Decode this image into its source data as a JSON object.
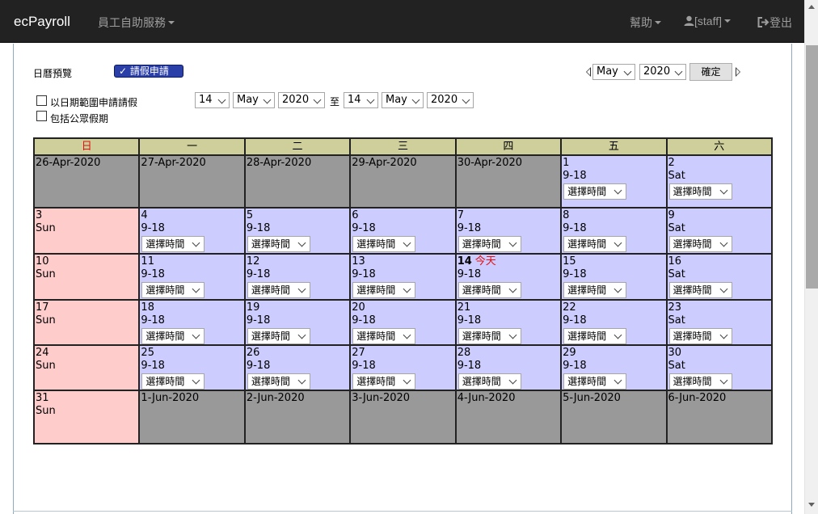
{
  "navbar": {
    "brand": "ecPayroll",
    "menu": "員工自助服務",
    "help": "幫助",
    "user": "[staff]",
    "logout": "登出"
  },
  "toolbar": {
    "calendar_preview": "日曆預覽",
    "leave_button": "請假申請",
    "month": "May",
    "year": "2020",
    "confirm": "確定"
  },
  "range": {
    "by_date_range_label": "以日期範圍申請請假",
    "include_holidays_label": "包括公眾假期",
    "from_day": "14",
    "from_month": "May",
    "from_year": "2020",
    "to_label": "至",
    "to_day": "14",
    "to_month": "May",
    "to_year": "2020"
  },
  "calendar": {
    "headers": [
      "日",
      "一",
      "二",
      "三",
      "四",
      "五",
      "六"
    ],
    "select_placeholder": "選擇時間",
    "today_label": "今天",
    "weeks": [
      [
        {
          "l1": "26-Apr-2020",
          "type": "gray"
        },
        {
          "l1": "27-Apr-2020",
          "type": "gray"
        },
        {
          "l1": "28-Apr-2020",
          "type": "gray"
        },
        {
          "l1": "29-Apr-2020",
          "type": "gray"
        },
        {
          "l1": "30-Apr-2020",
          "type": "gray"
        },
        {
          "l1": "1",
          "l2": "9-18",
          "type": "blue",
          "select": true
        },
        {
          "l1": "2",
          "l2": "Sat",
          "type": "blue",
          "select": true
        }
      ],
      [
        {
          "l1": "3",
          "l2": "Sun",
          "type": "pink"
        },
        {
          "l1": "4",
          "l2": "9-18",
          "type": "blue",
          "select": true
        },
        {
          "l1": "5",
          "l2": "9-18",
          "type": "blue",
          "select": true
        },
        {
          "l1": "6",
          "l2": "9-18",
          "type": "blue",
          "select": true
        },
        {
          "l1": "7",
          "l2": "9-18",
          "type": "blue",
          "select": true
        },
        {
          "l1": "8",
          "l2": "9-18",
          "type": "blue",
          "select": true
        },
        {
          "l1": "9",
          "l2": "Sat",
          "type": "blue",
          "select": true
        }
      ],
      [
        {
          "l1": "10",
          "l2": "Sun",
          "type": "pink"
        },
        {
          "l1": "11",
          "l2": "9-18",
          "type": "blue",
          "select": true
        },
        {
          "l1": "12",
          "l2": "9-18",
          "type": "blue",
          "select": true
        },
        {
          "l1": "13",
          "l2": "9-18",
          "type": "blue",
          "select": true
        },
        {
          "l1": "14",
          "l2": "9-18",
          "type": "blue",
          "select": true,
          "today": true
        },
        {
          "l1": "15",
          "l2": "9-18",
          "type": "blue",
          "select": true
        },
        {
          "l1": "16",
          "l2": "Sat",
          "type": "blue",
          "select": true
        }
      ],
      [
        {
          "l1": "17",
          "l2": "Sun",
          "type": "pink"
        },
        {
          "l1": "18",
          "l2": "9-18",
          "type": "blue",
          "select": true
        },
        {
          "l1": "19",
          "l2": "9-18",
          "type": "blue",
          "select": true
        },
        {
          "l1": "20",
          "l2": "9-18",
          "type": "blue",
          "select": true
        },
        {
          "l1": "21",
          "l2": "9-18",
          "type": "blue",
          "select": true
        },
        {
          "l1": "22",
          "l2": "9-18",
          "type": "blue",
          "select": true
        },
        {
          "l1": "23",
          "l2": "Sat",
          "type": "blue",
          "select": true
        }
      ],
      [
        {
          "l1": "24",
          "l2": "Sun",
          "type": "pink"
        },
        {
          "l1": "25",
          "l2": "9-18",
          "type": "blue",
          "select": true
        },
        {
          "l1": "26",
          "l2": "9-18",
          "type": "blue",
          "select": true
        },
        {
          "l1": "27",
          "l2": "9-18",
          "type": "blue",
          "select": true
        },
        {
          "l1": "28",
          "l2": "9-18",
          "type": "blue",
          "select": true
        },
        {
          "l1": "29",
          "l2": "9-18",
          "type": "blue",
          "select": true
        },
        {
          "l1": "30",
          "l2": "Sat",
          "type": "blue",
          "select": true
        }
      ],
      [
        {
          "l1": "31",
          "l2": "Sun",
          "type": "pink"
        },
        {
          "l1": "1-Jun-2020",
          "type": "gray"
        },
        {
          "l1": "2-Jun-2020",
          "type": "gray"
        },
        {
          "l1": "3-Jun-2020",
          "type": "gray"
        },
        {
          "l1": "4-Jun-2020",
          "type": "gray"
        },
        {
          "l1": "5-Jun-2020",
          "type": "gray"
        },
        {
          "l1": "6-Jun-2020",
          "type": "gray"
        }
      ]
    ]
  },
  "colors": {
    "navbar_bg": "#222222",
    "header_bg": "#cfcf9c",
    "out_of_month": "#999999",
    "sunday": "#ffcccc",
    "workday": "#ccccff",
    "today_text": "#e01010",
    "leave_button": "#2a3fa8"
  }
}
